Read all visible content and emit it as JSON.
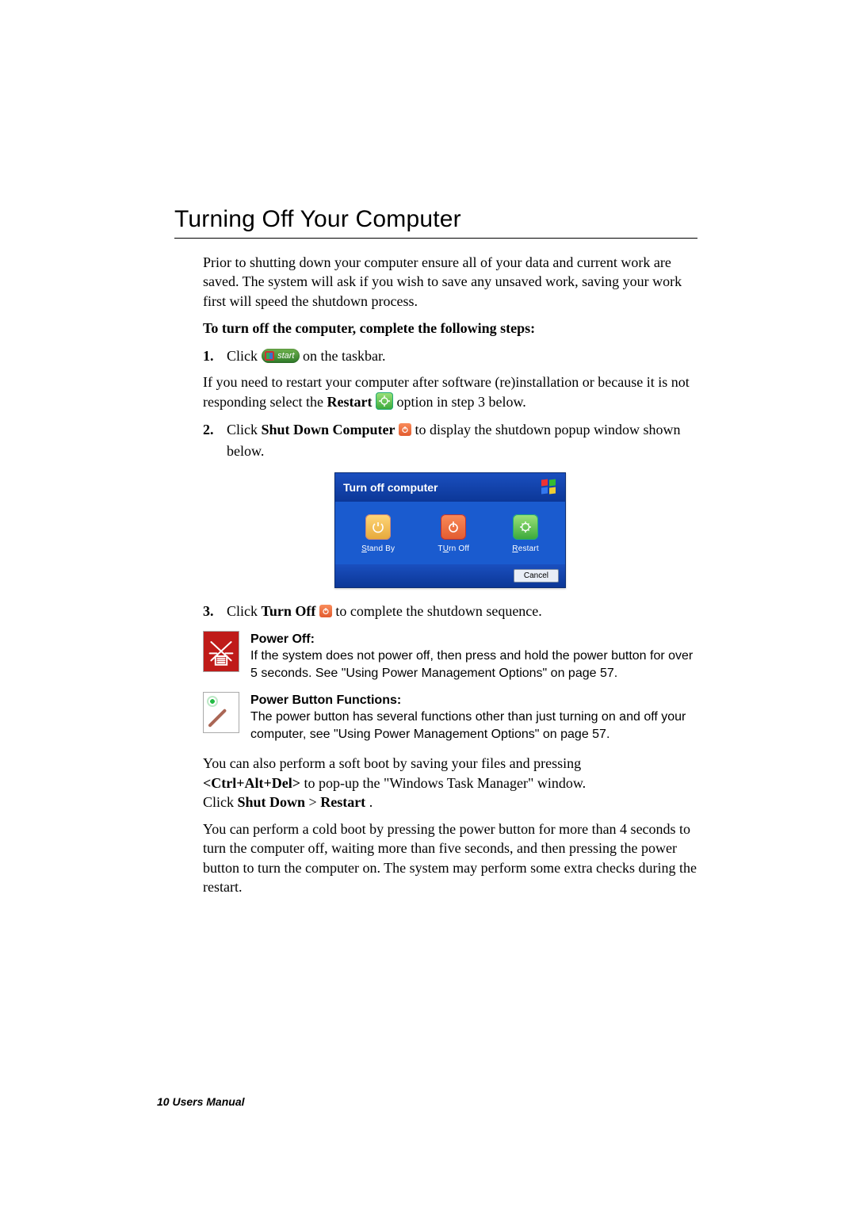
{
  "title": "Turning Off Your Computer",
  "intro": "Prior to shutting down your computer ensure all of your data and current work are saved. The system will ask if you wish to save any unsaved work, saving your work first will speed the shutdown process.",
  "steps_heading": "To turn off the computer, complete the following steps:",
  "step1": {
    "num": "1.",
    "pre": "Click ",
    "start_label": "start",
    "post": " on the taskbar."
  },
  "restart_note": {
    "pre": "If you need to restart your computer after software (re)installation or because it is not responding select the ",
    "bold": "Restart",
    "post": " option in step 3 below."
  },
  "step2": {
    "num": "2.",
    "pre": "Click ",
    "bold": "Shut Down Computer",
    "post": " to display the shutdown popup window shown below."
  },
  "dialog": {
    "title": "Turn off computer",
    "standby": "Stand By",
    "standby_u": "S",
    "turnoff": "Turn Off",
    "turnoff_u": "U",
    "restart": "Restart",
    "restart_u": "R",
    "cancel": "Cancel"
  },
  "step3": {
    "num": "3.",
    "pre": "Click ",
    "bold": "Turn Off",
    "post": " to complete the shutdown sequence."
  },
  "note_poweroff": {
    "hdr": "Power Off:",
    "body": "If the system does not power off, then press and hold the power button for over 5 seconds. See  \"Using Power Management Options\" on page 57."
  },
  "note_powerbtn": {
    "hdr": "Power Button Functions:",
    "body": "The power button has several functions other than just turning on and off your computer, see \"Using Power Management Options\" on page 57."
  },
  "softboot": {
    "l1a": "You can also perform a soft boot by saving your files and pressing ",
    "kb": "<Ctrl+Alt+Del>",
    "l1b": " to pop-up the \"Windows Task Manager\" window.",
    "l2a": "Click ",
    "sd": "Shut Down",
    "gt": " > ",
    "rs": "Restart",
    "l2b": "."
  },
  "coldboot": "You can perform a cold boot by pressing the power button for more than 4 seconds to turn the computer off, waiting more than five seconds, and then pressing the power button to turn the computer on. The system may perform some extra checks during the restart.",
  "footer": "10  Users Manual"
}
